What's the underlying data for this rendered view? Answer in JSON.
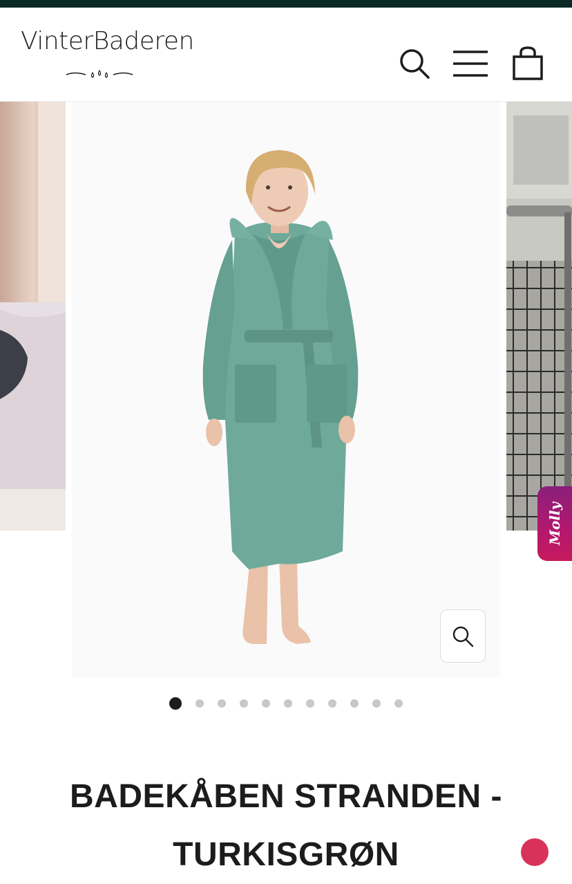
{
  "brand": {
    "logo_text": "VinterBaderen"
  },
  "header": {
    "icons": [
      "search-icon",
      "hamburger-menu-icon",
      "shopping-bag-icon"
    ]
  },
  "carousel": {
    "slide_count": 11,
    "active_index": 0
  },
  "chat_widget": {
    "label": "Molly"
  },
  "product": {
    "title_line1": "BADEKÅBEN STRANDEN -",
    "title_line2": "TURKISGRØN"
  },
  "colors": {
    "topbar": "#0b2a26",
    "robe": "#6fa99a",
    "chat_widget": "#b3186d",
    "text": "#1c1c1c"
  }
}
